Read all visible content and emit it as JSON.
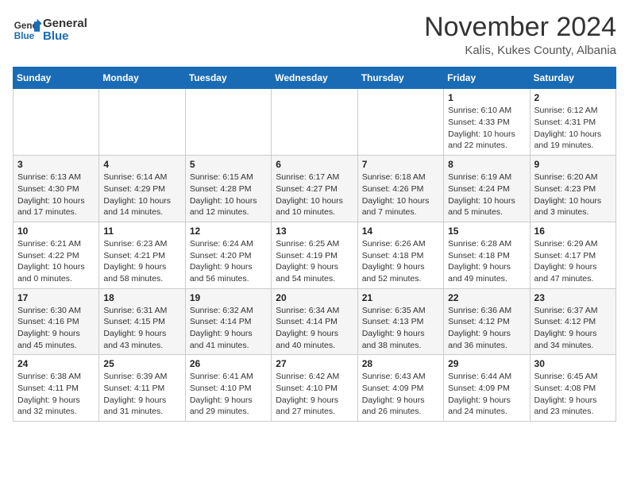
{
  "header": {
    "logo_line1": "General",
    "logo_line2": "Blue",
    "month_title": "November 2024",
    "location": "Kalis, Kukes County, Albania"
  },
  "weekdays": [
    "Sunday",
    "Monday",
    "Tuesday",
    "Wednesday",
    "Thursday",
    "Friday",
    "Saturday"
  ],
  "weeks": [
    [
      {
        "day": "",
        "info": ""
      },
      {
        "day": "",
        "info": ""
      },
      {
        "day": "",
        "info": ""
      },
      {
        "day": "",
        "info": ""
      },
      {
        "day": "",
        "info": ""
      },
      {
        "day": "1",
        "info": "Sunrise: 6:10 AM\nSunset: 4:33 PM\nDaylight: 10 hours\nand 22 minutes."
      },
      {
        "day": "2",
        "info": "Sunrise: 6:12 AM\nSunset: 4:31 PM\nDaylight: 10 hours\nand 19 minutes."
      }
    ],
    [
      {
        "day": "3",
        "info": "Sunrise: 6:13 AM\nSunset: 4:30 PM\nDaylight: 10 hours\nand 17 minutes."
      },
      {
        "day": "4",
        "info": "Sunrise: 6:14 AM\nSunset: 4:29 PM\nDaylight: 10 hours\nand 14 minutes."
      },
      {
        "day": "5",
        "info": "Sunrise: 6:15 AM\nSunset: 4:28 PM\nDaylight: 10 hours\nand 12 minutes."
      },
      {
        "day": "6",
        "info": "Sunrise: 6:17 AM\nSunset: 4:27 PM\nDaylight: 10 hours\nand 10 minutes."
      },
      {
        "day": "7",
        "info": "Sunrise: 6:18 AM\nSunset: 4:26 PM\nDaylight: 10 hours\nand 7 minutes."
      },
      {
        "day": "8",
        "info": "Sunrise: 6:19 AM\nSunset: 4:24 PM\nDaylight: 10 hours\nand 5 minutes."
      },
      {
        "day": "9",
        "info": "Sunrise: 6:20 AM\nSunset: 4:23 PM\nDaylight: 10 hours\nand 3 minutes."
      }
    ],
    [
      {
        "day": "10",
        "info": "Sunrise: 6:21 AM\nSunset: 4:22 PM\nDaylight: 10 hours\nand 0 minutes."
      },
      {
        "day": "11",
        "info": "Sunrise: 6:23 AM\nSunset: 4:21 PM\nDaylight: 9 hours\nand 58 minutes."
      },
      {
        "day": "12",
        "info": "Sunrise: 6:24 AM\nSunset: 4:20 PM\nDaylight: 9 hours\nand 56 minutes."
      },
      {
        "day": "13",
        "info": "Sunrise: 6:25 AM\nSunset: 4:19 PM\nDaylight: 9 hours\nand 54 minutes."
      },
      {
        "day": "14",
        "info": "Sunrise: 6:26 AM\nSunset: 4:18 PM\nDaylight: 9 hours\nand 52 minutes."
      },
      {
        "day": "15",
        "info": "Sunrise: 6:28 AM\nSunset: 4:18 PM\nDaylight: 9 hours\nand 49 minutes."
      },
      {
        "day": "16",
        "info": "Sunrise: 6:29 AM\nSunset: 4:17 PM\nDaylight: 9 hours\nand 47 minutes."
      }
    ],
    [
      {
        "day": "17",
        "info": "Sunrise: 6:30 AM\nSunset: 4:16 PM\nDaylight: 9 hours\nand 45 minutes."
      },
      {
        "day": "18",
        "info": "Sunrise: 6:31 AM\nSunset: 4:15 PM\nDaylight: 9 hours\nand 43 minutes."
      },
      {
        "day": "19",
        "info": "Sunrise: 6:32 AM\nSunset: 4:14 PM\nDaylight: 9 hours\nand 41 minutes."
      },
      {
        "day": "20",
        "info": "Sunrise: 6:34 AM\nSunset: 4:14 PM\nDaylight: 9 hours\nand 40 minutes."
      },
      {
        "day": "21",
        "info": "Sunrise: 6:35 AM\nSunset: 4:13 PM\nDaylight: 9 hours\nand 38 minutes."
      },
      {
        "day": "22",
        "info": "Sunrise: 6:36 AM\nSunset: 4:12 PM\nDaylight: 9 hours\nand 36 minutes."
      },
      {
        "day": "23",
        "info": "Sunrise: 6:37 AM\nSunset: 4:12 PM\nDaylight: 9 hours\nand 34 minutes."
      }
    ],
    [
      {
        "day": "24",
        "info": "Sunrise: 6:38 AM\nSunset: 4:11 PM\nDaylight: 9 hours\nand 32 minutes."
      },
      {
        "day": "25",
        "info": "Sunrise: 6:39 AM\nSunset: 4:11 PM\nDaylight: 9 hours\nand 31 minutes."
      },
      {
        "day": "26",
        "info": "Sunrise: 6:41 AM\nSunset: 4:10 PM\nDaylight: 9 hours\nand 29 minutes."
      },
      {
        "day": "27",
        "info": "Sunrise: 6:42 AM\nSunset: 4:10 PM\nDaylight: 9 hours\nand 27 minutes."
      },
      {
        "day": "28",
        "info": "Sunrise: 6:43 AM\nSunset: 4:09 PM\nDaylight: 9 hours\nand 26 minutes."
      },
      {
        "day": "29",
        "info": "Sunrise: 6:44 AM\nSunset: 4:09 PM\nDaylight: 9 hours\nand 24 minutes."
      },
      {
        "day": "30",
        "info": "Sunrise: 6:45 AM\nSunset: 4:08 PM\nDaylight: 9 hours\nand 23 minutes."
      }
    ]
  ]
}
